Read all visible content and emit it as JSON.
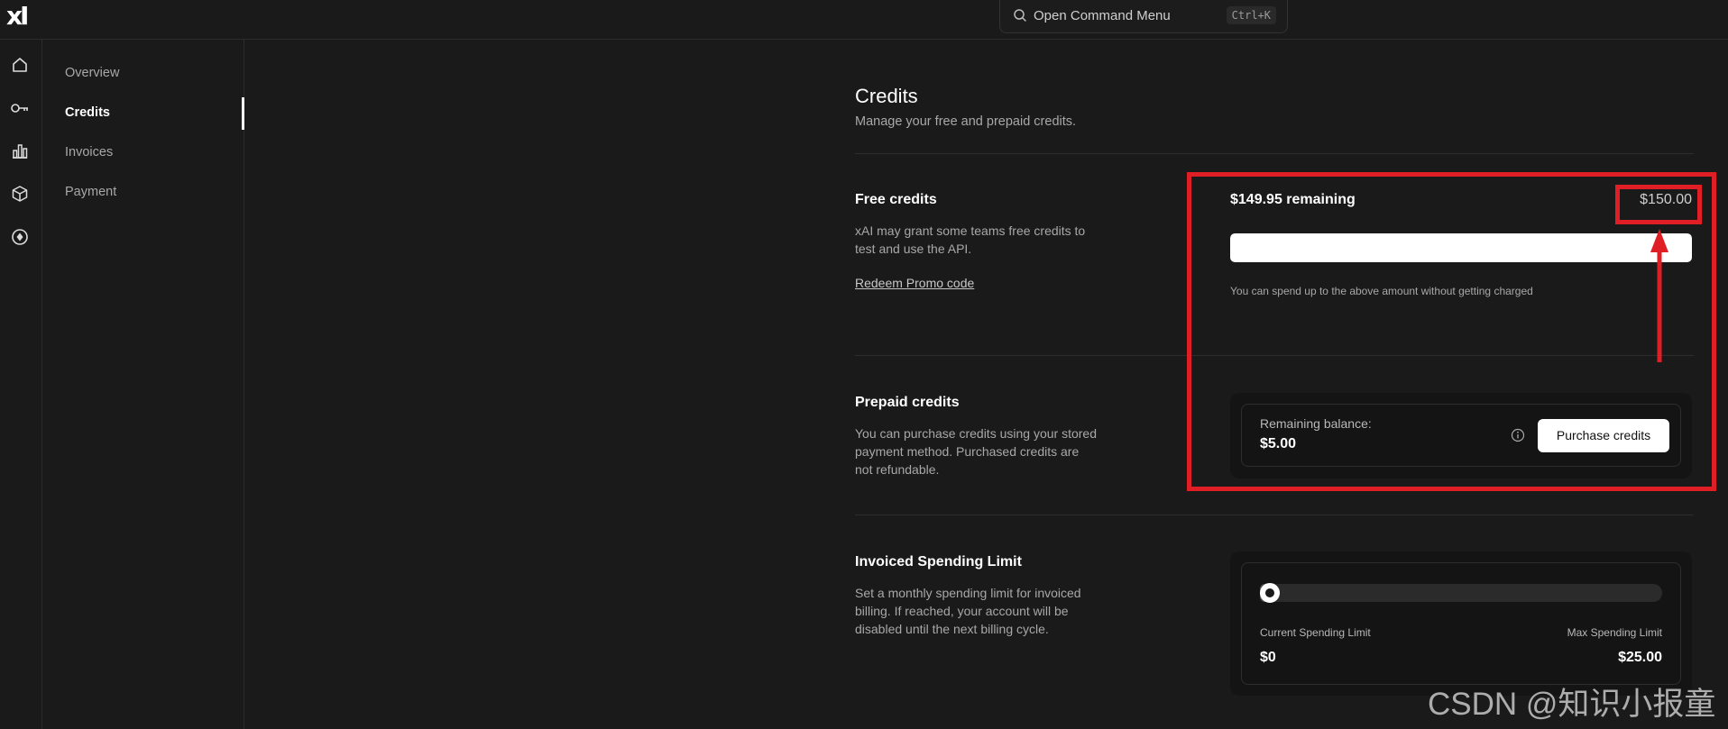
{
  "app": {
    "logo": "xI"
  },
  "command": {
    "label": "Open Command Menu",
    "shortcut": "Ctrl+K"
  },
  "rail": {
    "icons": [
      "home-icon",
      "key-icon",
      "chart-icon",
      "cube-icon",
      "compass-icon"
    ]
  },
  "subnav": {
    "items": [
      {
        "label": "Overview"
      },
      {
        "label": "Credits",
        "active": true
      },
      {
        "label": "Invoices"
      },
      {
        "label": "Payment"
      }
    ]
  },
  "page": {
    "title": "Credits",
    "subtitle": "Manage your free and prepaid credits."
  },
  "free_credits": {
    "title": "Free credits",
    "desc": "xAI may grant some teams free credits to test and use the API.",
    "redeem": "Redeem Promo code",
    "remaining": "$149.95 remaining",
    "total": "$150.00",
    "fill_fraction": 0.9997,
    "note": "You can spend up to the above amount without getting charged"
  },
  "prepaid": {
    "title": "Prepaid credits",
    "desc": "You can purchase credits using your stored payment method. Purchased credits are not refundable.",
    "balance_label": "Remaining balance:",
    "balance": "$5.00",
    "button": "Purchase credits"
  },
  "spending_limit": {
    "title": "Invoiced Spending Limit",
    "desc": "Set a monthly spending limit for invoiced billing. If reached, your account will be disabled until the next billing cycle.",
    "current_label": "Current Spending Limit",
    "current_value": "$0",
    "max_label": "Max Spending Limit",
    "max_value": "$25.00",
    "fraction": 0
  },
  "colors": {
    "annotation": "#e01e26",
    "background": "#1a1a1a"
  },
  "watermark": "CSDN @知识小报童"
}
